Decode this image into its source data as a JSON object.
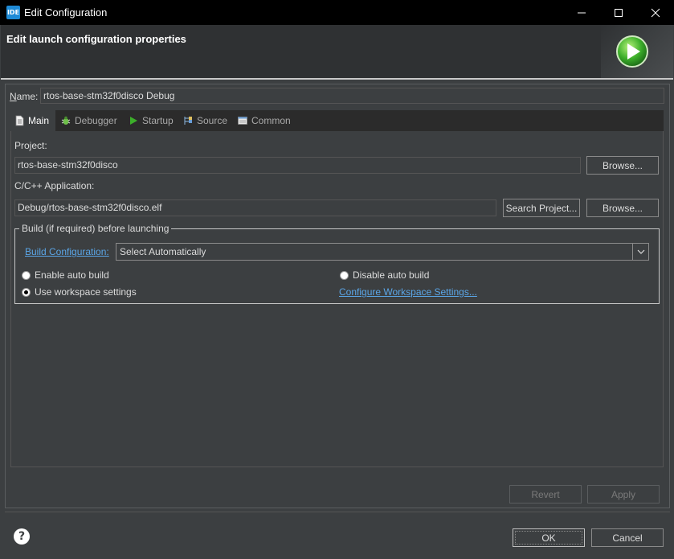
{
  "window": {
    "icon_text": "IDE",
    "title": "Edit Configuration",
    "minimize_icon": "minimize-icon",
    "maximize_icon": "maximize-icon",
    "close_icon": "close-icon"
  },
  "header": {
    "title": "Edit launch configuration properties",
    "icon": "run-icon"
  },
  "name": {
    "label_prefix": "N",
    "label_rest": "ame:",
    "value": "rtos-base-stm32f0disco Debug"
  },
  "tabs": [
    {
      "label": "Main",
      "icon": "document-icon",
      "active": true
    },
    {
      "label": "Debugger",
      "icon": "bug-icon",
      "active": false
    },
    {
      "label": "Startup",
      "icon": "play-icon",
      "active": false
    },
    {
      "label": "Source",
      "icon": "source-icon",
      "active": false
    },
    {
      "label": "Common",
      "icon": "common-icon",
      "active": false
    }
  ],
  "main": {
    "project_label": "Project:",
    "project_value": "rtos-base-stm32f0disco",
    "project_browse": "Browse...",
    "app_label": "C/C++ Application:",
    "app_value": "Debug/rtos-base-stm32f0disco.elf",
    "search_project": "Search Project...",
    "app_browse": "Browse...",
    "build_group_title": "Build (if required) before launching",
    "build_config_link": "Build Configuration:",
    "build_config_value": "Select Automatically",
    "enable_auto_build": "Enable auto build",
    "disable_auto_build": "Disable auto build",
    "use_workspace_settings": "Use workspace settings",
    "configure_workspace_link": "Configure Workspace Settings..."
  },
  "actions": {
    "revert": "Revert",
    "apply": "Apply"
  },
  "footer": {
    "help_icon": "help-icon",
    "ok": "OK",
    "cancel": "Cancel"
  },
  "colors": {
    "background": "#3c3f41",
    "titlebar": "#000000",
    "link": "#5aa5e6"
  }
}
